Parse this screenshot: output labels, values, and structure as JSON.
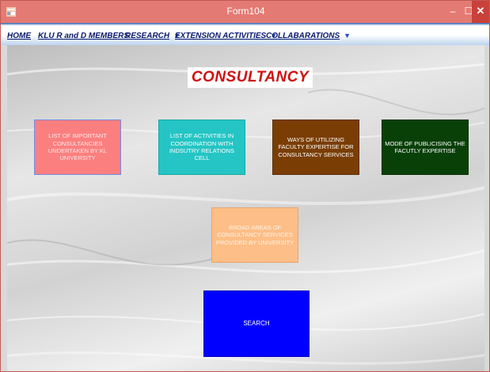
{
  "window": {
    "title": "Form104",
    "icon": "app-form-icon",
    "controls": {
      "minimize": "–",
      "maximize": "☐",
      "close": "✕"
    }
  },
  "menu": {
    "items": [
      {
        "label": "HOME",
        "has_dropdown": false
      },
      {
        "label": "KLU R and D MEMBERS",
        "has_dropdown": false
      },
      {
        "label": "RESEARCH",
        "has_dropdown": true
      },
      {
        "label": "EXTENSION ACTIVITIES",
        "has_dropdown": true
      },
      {
        "label": "COLLABARATIONS",
        "has_dropdown": true
      }
    ],
    "dropdown_glyph": "▼"
  },
  "page": {
    "heading": "CONSULTANCY"
  },
  "tiles": [
    {
      "label": "LIST OF IMPORTANT CONSULTANCIES UNDERTAKEN BY KL UNIVERSITY",
      "color": "#fb7f7f"
    },
    {
      "label": "LIST OF ACTIVITIES IN COORDINATION WITH INDSUTRY RELATIONS CELL",
      "color": "#24c5c4"
    },
    {
      "label": "WAYS OF UTILIZING FACULTY EXPERTISE FOR CONSULTANCY SERVICES",
      "color": "#7a3e05"
    },
    {
      "label": "MODE OF PUBLICISING THE FACUTLY EXPERTISE",
      "color": "#084008"
    },
    {
      "label": "BROAD AREAS OF CONSULTANCY SERVICES PROVIDED BY UNIVERSITY",
      "color": "#fdbe87"
    },
    {
      "label": "SEARCH",
      "color": "#0000ff"
    }
  ],
  "colors": {
    "titlebar": "#e47a74",
    "close_button": "#c8413a",
    "menu_text": "#0b1a6e",
    "heading_text": "#d01010"
  }
}
